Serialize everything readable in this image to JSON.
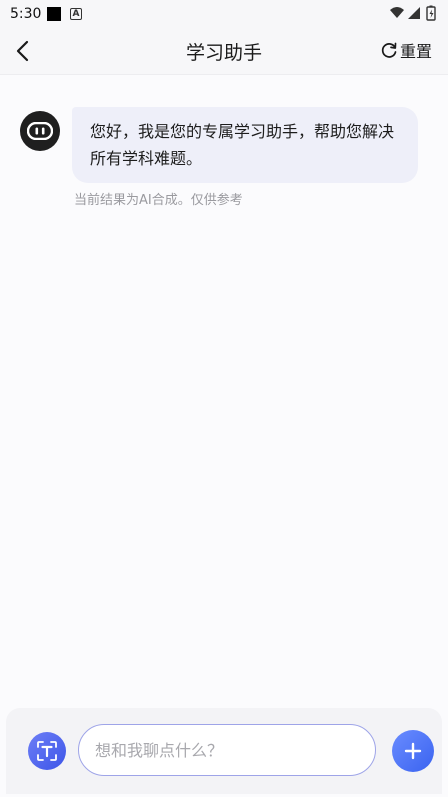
{
  "status_bar": {
    "time": "5:30",
    "notification_a": "A"
  },
  "header": {
    "title": "学习助手",
    "reset_label": "重置"
  },
  "chat": {
    "messages": [
      {
        "sender": "assistant",
        "text": "您好，我是您的专属学习助手，帮助您解决所有学科难题。"
      }
    ],
    "disclaimer": "当前结果为AI合成。仅供参考"
  },
  "input_bar": {
    "placeholder": "想和我聊点什么？",
    "value": ""
  },
  "colors": {
    "accent": "#4a63f0",
    "bubble_bg": "#eeeff9",
    "input_border": "#9ea4e8",
    "disclaimer_text": "#9a9a9f"
  },
  "icons": {
    "back": "chevron-left-icon",
    "reset": "refresh-icon",
    "avatar": "robot-face-icon",
    "text_mode": "text-scan-icon",
    "add": "plus-icon"
  }
}
